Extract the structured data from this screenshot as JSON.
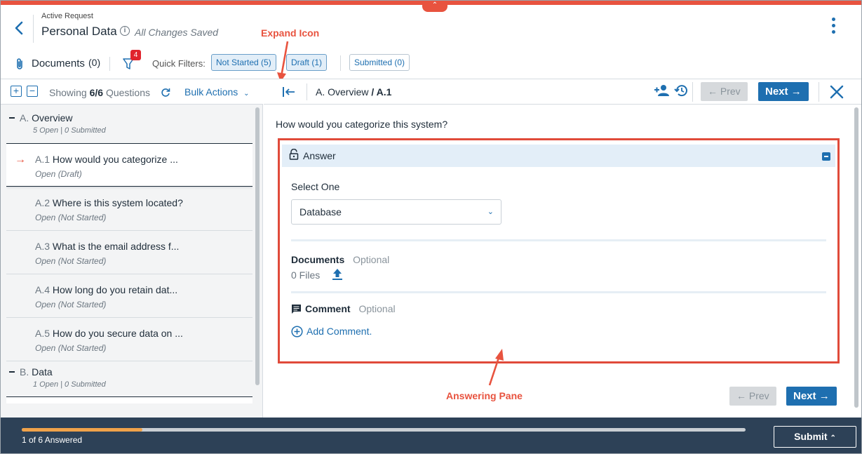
{
  "header": {
    "eyebrow": "Active Request",
    "title": "Personal Data",
    "info_glyph": "i",
    "saved_status": "All Changes Saved"
  },
  "annotations": {
    "expand_icon": "Expand Icon",
    "answering_pane": "Answering Pane"
  },
  "toolbar": {
    "documents_label": "Documents",
    "documents_count": "(0)",
    "filter_badge": "4",
    "quick_filters_label": "Quick Filters:",
    "chips": [
      {
        "label": "Not Started (5)",
        "active": true
      },
      {
        "label": "Draft (1)",
        "active": true
      },
      {
        "label": "Submitted (0)",
        "active": false
      }
    ]
  },
  "left_pane": {
    "expand_all": "+",
    "collapse_all": "−",
    "showing_prefix": "Showing",
    "showing_count": "6/6",
    "showing_suffix": "Questions",
    "bulk_actions": "Bulk Actions",
    "sections": [
      {
        "prefix": "A.",
        "title": "Overview",
        "summary": "5 Open | 0 Submitted",
        "questions": [
          {
            "id": "A.1",
            "text": "How would you categorize ...",
            "status": "Open  (Draft)",
            "selected": true
          },
          {
            "id": "A.2",
            "text": "Where is this system located?",
            "status": "Open  (Not Started)"
          },
          {
            "id": "A.3",
            "text": "What is the email address f...",
            "status": "Open  (Not Started)"
          },
          {
            "id": "A.4",
            "text": "How long do you retain dat...",
            "status": "Open  (Not Started)"
          },
          {
            "id": "A.5",
            "text": "How do you secure data on ...",
            "status": "Open  (Not Started)"
          }
        ]
      },
      {
        "prefix": "B.",
        "title": "Data",
        "summary": "1 Open | 0 Submitted",
        "questions": []
      }
    ]
  },
  "right_pane": {
    "breadcrumb_section": "A. Overview",
    "breadcrumb_sep": " / ",
    "breadcrumb_item": "A.1",
    "prev_label": "Prev",
    "next_label": "Next",
    "question": "How would you categorize this system?",
    "answer_title": "Answer",
    "select_label": "Select One",
    "select_value": "Database",
    "documents_label": "Documents",
    "optional": "Optional",
    "files": "0 Files",
    "comment_label": "Comment",
    "add_comment": "Add Comment."
  },
  "footer": {
    "progress_fraction": 0.1667,
    "progress_text": "1 of 6 Answered",
    "submit_label": "Submit"
  },
  "colors": {
    "accent": "#1e6fb0",
    "alert": "#e8533f",
    "footer_bg": "#2d4157",
    "progress": "#f0a24a"
  },
  "icons": [
    "back-arrow-icon",
    "info-icon",
    "kebab-icon",
    "paperclip-icon",
    "filter-icon",
    "refresh-icon",
    "chevron-down-icon",
    "expand-icon",
    "assign-user-icon",
    "history-icon",
    "close-icon",
    "lock-icon",
    "collapse-icon",
    "upload-icon",
    "comment-icon",
    "add-circle-icon",
    "chevron-up-icon"
  ]
}
